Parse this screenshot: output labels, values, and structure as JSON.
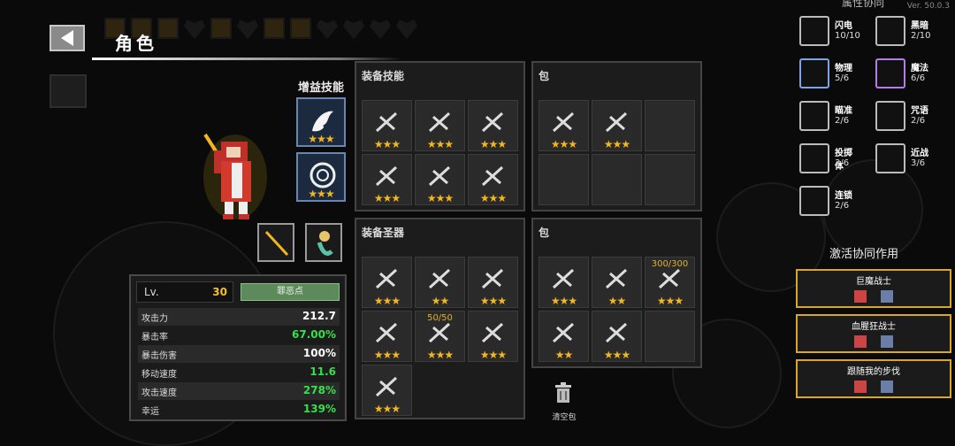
{
  "version": "Ver. 50.0.3",
  "header": {
    "title": "角色"
  },
  "boost_label": "增益技能",
  "stats": {
    "lv_label": "Lv.",
    "lv_value": "30",
    "karma_label": "罪恶点",
    "rows": [
      {
        "label": "攻击力",
        "value": "212.7",
        "color": "#ffffff"
      },
      {
        "label": "暴击率",
        "value": "67.00%",
        "color": "#35e04a"
      },
      {
        "label": "暴击伤害",
        "value": "100%",
        "color": "#ffffff"
      },
      {
        "label": "移动速度",
        "value": "11.6",
        "color": "#35e04a"
      },
      {
        "label": "攻击速度",
        "value": "278%",
        "color": "#35e04a"
      },
      {
        "label": "幸运",
        "value": "139%",
        "color": "#35e04a"
      }
    ]
  },
  "equip_skills": {
    "title": "装备技能",
    "slots": [
      "★★★",
      "★★★",
      "★★★",
      "★★★",
      "★★★",
      "★★★"
    ]
  },
  "bag_top": {
    "title": "包",
    "slots": [
      "★★★",
      "★★★",
      "",
      "",
      "",
      ""
    ]
  },
  "equip_relics": {
    "title": "装备圣器",
    "slots": [
      {
        "stars": "★★★",
        "count": ""
      },
      {
        "stars": "★★",
        "count": ""
      },
      {
        "stars": "★★★",
        "count": ""
      },
      {
        "stars": "★★★",
        "count": ""
      },
      {
        "stars": "★★★",
        "count": "50/50"
      },
      {
        "stars": "★★★",
        "count": ""
      },
      {
        "stars": "★★★",
        "count": ""
      }
    ]
  },
  "bag_bottom": {
    "title": "包",
    "slots": [
      {
        "stars": "★★★",
        "count": ""
      },
      {
        "stars": "★★",
        "count": ""
      },
      {
        "stars": "★★★",
        "count": "300/300"
      },
      {
        "stars": "★★",
        "count": ""
      },
      {
        "stars": "★★★",
        "count": ""
      },
      {
        "stars": "",
        "count": ""
      }
    ]
  },
  "clear_bag_label": "清空包",
  "synergy": {
    "title": "属性协同",
    "items": [
      {
        "name": "闪电",
        "value": "10/10",
        "icon": "lightning-icon",
        "border": "#bbbbbb",
        "name_color": "#ffffff"
      },
      {
        "name": "黑暗",
        "value": "2/10",
        "icon": "dark-icon",
        "border": "#bbbbbb",
        "name_color": "#ffffff"
      },
      {
        "name": "物理",
        "value": "5/6",
        "icon": "sword-icon",
        "border": "#7aa6e8",
        "name_color": "#ffffff"
      },
      {
        "name": "魔法",
        "value": "6/6",
        "icon": "magic-icon",
        "border": "#b37ee8",
        "name_color": "#ffffff"
      },
      {
        "name": "瞄准",
        "value": "2/6",
        "icon": "crosshair-icon",
        "border": "#bbbbbb",
        "name_color": "#ffffff"
      },
      {
        "name": "咒语",
        "value": "2/6",
        "icon": "spell-icon",
        "border": "#bbbbbb",
        "name_color": "#ffffff"
      },
      {
        "name": "投掷体",
        "value": "3/6",
        "icon": "projectile-icon",
        "border": "#bbbbbb",
        "name_color": "#ffffff"
      },
      {
        "name": "近战",
        "value": "3/6",
        "icon": "fist-icon",
        "border": "#bbbbbb",
        "name_color": "#ffffff"
      },
      {
        "name": "连锁",
        "value": "2/6",
        "icon": "chain-icon",
        "border": "#bbbbbb",
        "name_color": "#ffffff"
      }
    ]
  },
  "activate_label": "激活协同作用",
  "sets": [
    {
      "name": "巨魔战士",
      "color": "#ffffff"
    },
    {
      "name": "血腥狂战士",
      "color": "#ffffff"
    },
    {
      "name": "跟随我的步伐",
      "color": "#ffffff"
    }
  ]
}
